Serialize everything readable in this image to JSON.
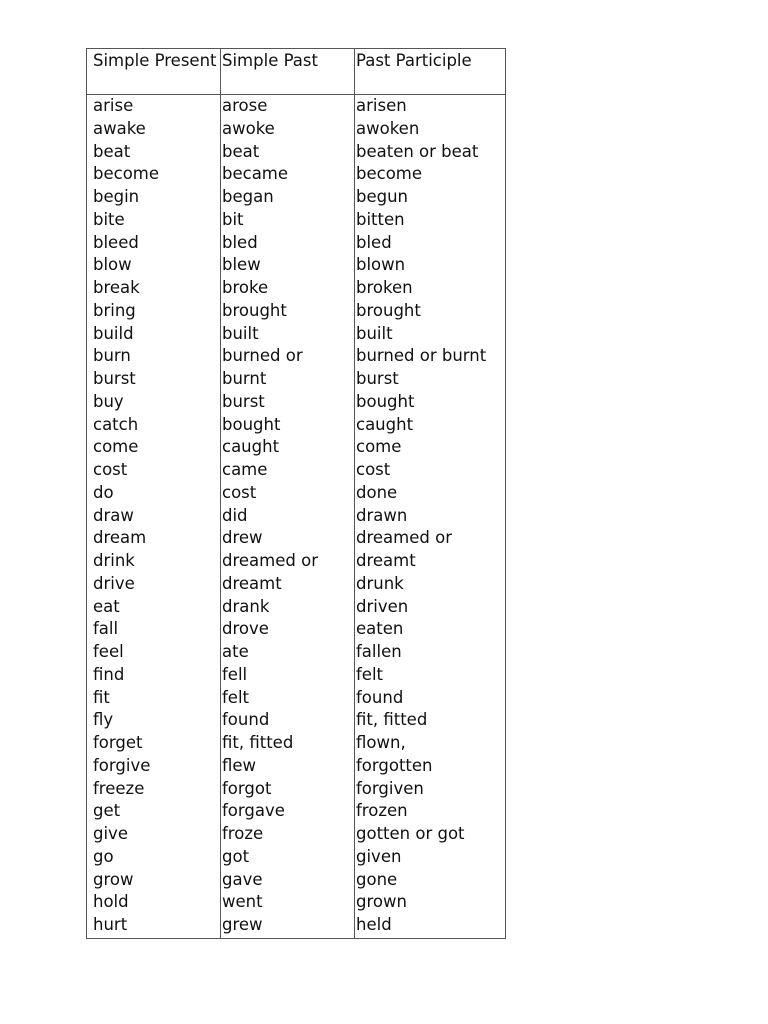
{
  "table": {
    "headers": [
      "Simple Present",
      "Simple Past",
      "Past Participle"
    ],
    "columns": {
      "simple_present": [
        "arise",
        "awake",
        "beat",
        "become",
        "begin",
        "bite",
        "bleed",
        "blow",
        "break",
        "bring",
        "build",
        "burn",
        "burst",
        "buy",
        "catch",
        "come",
        "cost",
        "do",
        "draw",
        "dream",
        "drink",
        "drive",
        "eat",
        "fall",
        "feel",
        "find",
        "fit",
        "fly",
        "forget",
        "forgive",
        "freeze",
        "get",
        "give",
        "go",
        "grow",
        "hold",
        "hurt"
      ],
      "simple_past": [
        "arose",
        "awoke",
        "beat",
        "became",
        "began",
        "bit",
        "bled",
        "blew",
        "broke",
        "brought",
        "built",
        "burned or",
        "burnt",
        "burst",
        "bought",
        "caught",
        "came",
        "cost",
        "did",
        "drew",
        "dreamed or",
        "dreamt",
        "drank",
        "drove",
        "ate",
        "fell",
        "felt",
        "found",
        "fit, fitted",
        "flew",
        "forgot",
        "forgave",
        "froze",
        "got",
        "gave",
        "went",
        "grew"
      ],
      "past_participle": [
        "arisen",
        "awoken",
        "beaten or beat",
        "become",
        "begun",
        "bitten",
        "bled",
        "blown",
        "broken",
        "brought",
        "built",
        "burned or burnt",
        "burst",
        "bought",
        "caught",
        "come",
        "cost",
        "done",
        "drawn",
        "dreamed or",
        "dreamt",
        "drunk",
        "driven",
        "eaten",
        "fallen",
        "felt",
        "found",
        "fit, fitted",
        "flown,",
        "forgotten",
        "forgiven",
        "frozen",
        "gotten or got",
        "given",
        "gone",
        "grown",
        "held"
      ]
    }
  }
}
